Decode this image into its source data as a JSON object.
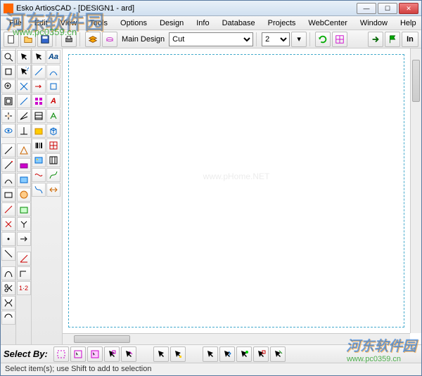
{
  "title": "Esko ArtiosCAD - [DESIGN1 - ard]",
  "winbtns": {
    "min": "—",
    "max": "☐",
    "close": "✕"
  },
  "menu": [
    "File",
    "Edit",
    "View",
    "Tools",
    "Options",
    "Design",
    "Info",
    "Database",
    "Projects",
    "WebCenter",
    "Window",
    "Help"
  ],
  "toolbar": {
    "main_design": "Main Design",
    "layer_combo": "Cut",
    "num_combo": "2",
    "in_btn": "In"
  },
  "selectby": {
    "label": "Select By:"
  },
  "status": "Select item(s); use Shift to add to selection",
  "watermark": {
    "big": "河东软件园",
    "url": "www.pc0359.cn",
    "br": "河东软件园",
    "br_url": "www.pc0359.cn",
    "center": "www.pHome.NET"
  },
  "colors": {
    "accent": "#3a7abd",
    "dash": "#44aacc"
  }
}
